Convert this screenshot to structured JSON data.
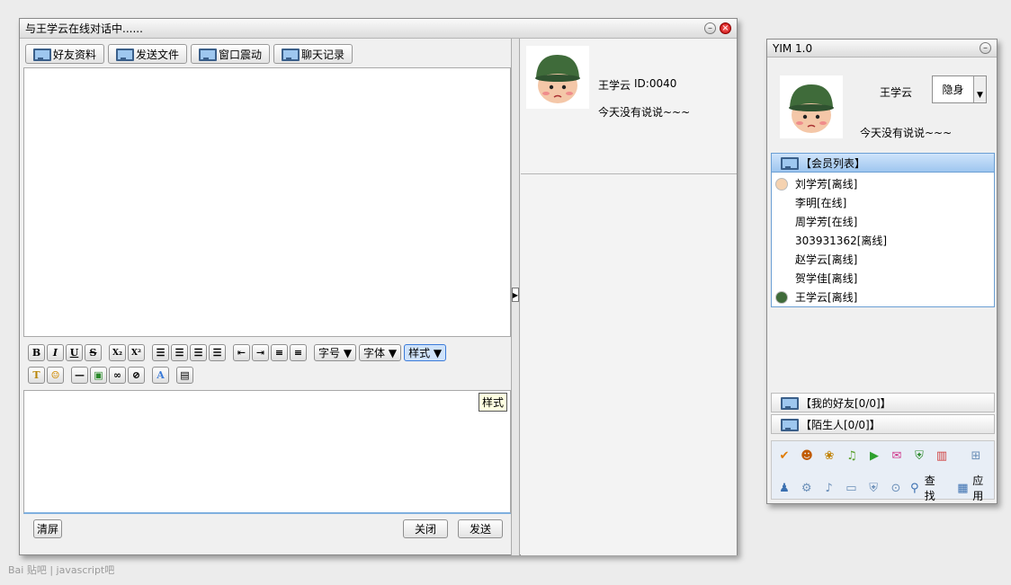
{
  "chat_window": {
    "title": "与王学云在线对话中......",
    "toolbar": {
      "profile": "好友资料",
      "send_file": "发送文件",
      "shake": "窗口震动",
      "history": "聊天记录"
    },
    "format": {
      "bold": "B",
      "italic": "I",
      "underline": "U",
      "strike": "S",
      "subscript": "X₂",
      "superscript": "X²",
      "font_size": "字号 ▼",
      "font_family": "字体 ▼",
      "style": "样式 ▼",
      "style_tooltip": "样式"
    },
    "buttons": {
      "clear": "清屏",
      "close": "关闭",
      "send": "发送"
    },
    "peer": {
      "name": "王学云",
      "id": "ID:0040",
      "status": "今天没有说说~~~"
    }
  },
  "yim": {
    "title": "YIM 1.0",
    "user": {
      "name": "王学云",
      "status_select": "隐身",
      "signature": "今天没有说说~~~"
    },
    "groups": {
      "members": "【会员列表】",
      "friends": "【我的好友[0/0]】",
      "strangers": "【陌生人[0/0]】"
    },
    "contacts": [
      {
        "label": "刘学芳[离线]"
      },
      {
        "label": "李明[在线]"
      },
      {
        "label": "周学芳[在线]"
      },
      {
        "label": "303931362[离线]"
      },
      {
        "label": "赵学云[离线]"
      },
      {
        "label": "贺学佳[离线]"
      },
      {
        "label": "王学云[离线]"
      }
    ],
    "bottom": {
      "find": "查找",
      "apps": "应用"
    }
  },
  "watermark": "Bai 贴吧 | javascript吧",
  "colors": {
    "accent_blue": "#3b7bd8",
    "group_header": "#a9cdf4",
    "close_red": "#c00000"
  }
}
